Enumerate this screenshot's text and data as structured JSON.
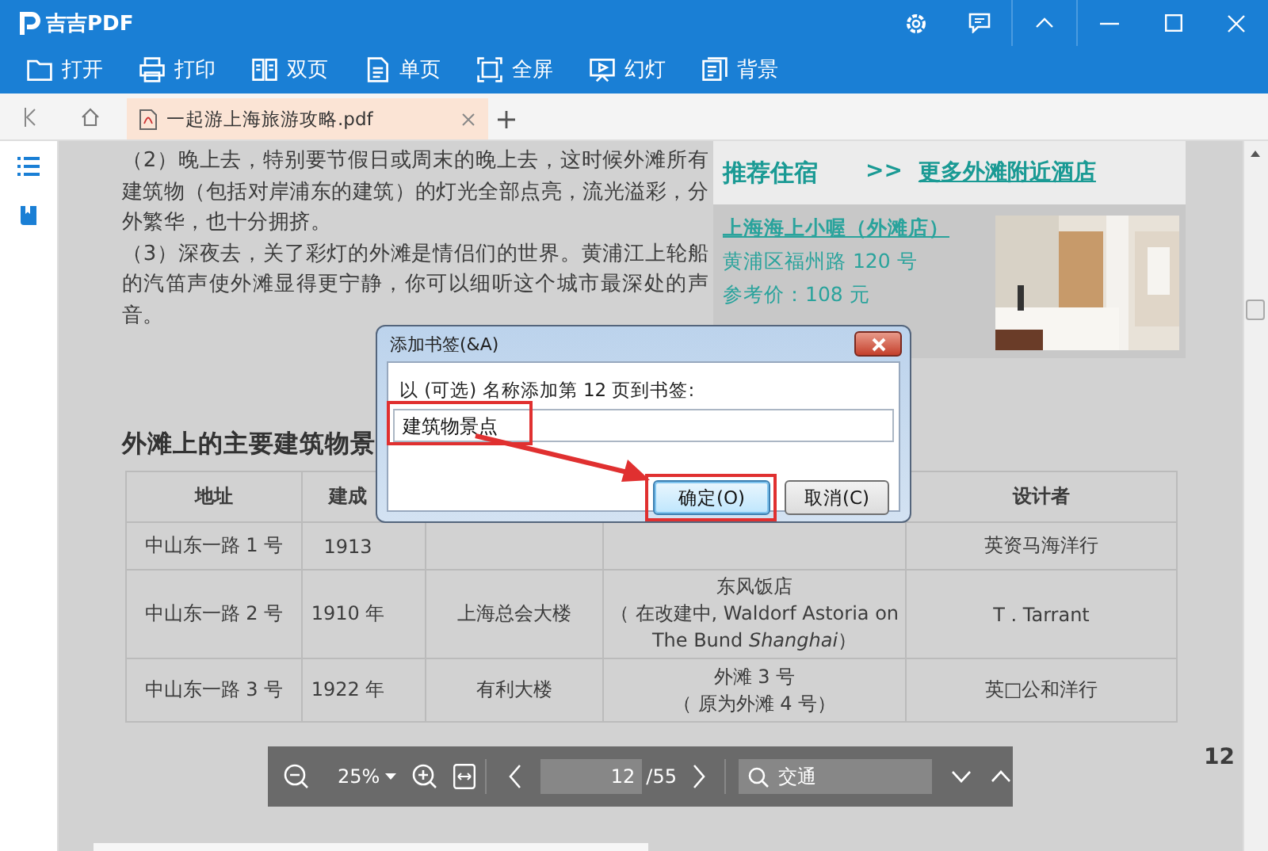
{
  "app": {
    "name": "吉吉PDF"
  },
  "toolbar": [
    {
      "kind": "open",
      "label": "打开"
    },
    {
      "kind": "print",
      "label": "打印"
    },
    {
      "kind": "double",
      "label": "双页"
    },
    {
      "kind": "single",
      "label": "单页"
    },
    {
      "kind": "fullscreen",
      "label": "全屏"
    },
    {
      "kind": "slideshow",
      "label": "幻灯"
    },
    {
      "kind": "background",
      "label": "背景"
    }
  ],
  "tabs": [
    {
      "label": "一起游上海旅游攻略.pdf",
      "selected": true
    }
  ],
  "document": {
    "paragraphs": [
      "（2）晚上去，特别要节假日或周末的晚上去，这时候外滩所有建筑物（包括对岸浦东的建筑）的灯光全部点亮，流光溢彩，分外繁华，也十分拥挤。",
      "（3）深夜去，关了彩灯的外滩是情侣们的世界。黄浦江上轮船的汽笛声使外滩显得更宁静，你可以细听这个城市最深处的声音。"
    ],
    "hotel_box": {
      "title": "推荐住宿",
      "more_prefix": ">>",
      "more_link": "更多外滩附近酒店",
      "hotel": {
        "name": "上海海上小喔（外滩店）",
        "address": "黄浦区福州路 120 号",
        "price": "参考价：108 元"
      }
    },
    "heading": "外滩上的主要建筑物景",
    "table": {
      "columns": [
        "地址",
        "建成",
        null,
        null,
        "设计者"
      ],
      "rows": [
        [
          "中山东一路 1 号",
          "1913",
          null,
          null,
          "英资马海洋行"
        ],
        [
          "中山东一路 2 号",
          "1910 年",
          "上海总会大楼",
          [
            "东风饭店",
            "（ 在改建中, Waldorf Astoria on The Bund *Shanghai*）"
          ],
          "T . Tarrant"
        ],
        [
          "中山东一路 3 号",
          "1922 年",
          "有利大楼",
          [
            "外滩 3 号",
            "（ 原为外滩 4 号）"
          ],
          "英□公和洋行"
        ]
      ]
    },
    "page_number": "12"
  },
  "dialog": {
    "title": "添加书签(&A)",
    "prompt": "以 (可选) 名称添加第 12 页到书签:",
    "value": "建筑物景点",
    "buttons": [
      {
        "label": "确定(O)",
        "default": true
      },
      {
        "label": "取消(C)",
        "default": false
      }
    ]
  },
  "page_toolbar": {
    "zoom": "25%",
    "page": "12",
    "total": "/55",
    "search": "交通"
  }
}
